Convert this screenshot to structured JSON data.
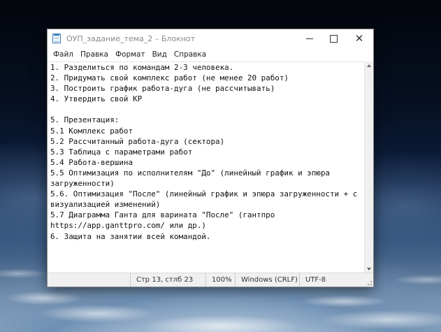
{
  "window": {
    "title": "ОУП_задание_тема_2 – Блокнот",
    "icon": "notepad-icon",
    "controls": {
      "minimize": "minimize-icon",
      "maximize": "maximize-icon",
      "close": "✕"
    }
  },
  "menu": {
    "items": [
      {
        "label": "Файл"
      },
      {
        "label": "Правка"
      },
      {
        "label": "Формат"
      },
      {
        "label": "Вид"
      },
      {
        "label": "Справка"
      }
    ]
  },
  "editor": {
    "lines": [
      "1. Разделиться по командам 2-3 человека.",
      "2. Придумать свой комплекс работ (не менее 20 работ)",
      "3. Построить график работа-дуга (не рассчитывать)",
      "4. Утвердить свой КР",
      "",
      "5. Презентация:",
      "5.1 Комплекс работ",
      "5.2 Рассчитанный работа-дуга (сектора)",
      "5.3 Таблица с параметрами работ",
      "5.4 Работа-вершина",
      "5.5 Оптимизация по исполнителям \"До\" (линейный график и эпюра",
      "загруженности)",
      "5.6. Оптимизация \"После\" (линейный график и эпюра загруженности + с",
      "визуализацией изменений)",
      "5.7 Диаграмма Ганта для варината \"После\" (гантпро",
      "https://app.ganttpro.com/ или др.)",
      "6. Защита на занятии всей командой."
    ]
  },
  "status": {
    "position": "Стр 13, стлб 23",
    "zoom": "100%",
    "line_ending": "Windows (CRLF)",
    "encoding": "UTF-8"
  }
}
